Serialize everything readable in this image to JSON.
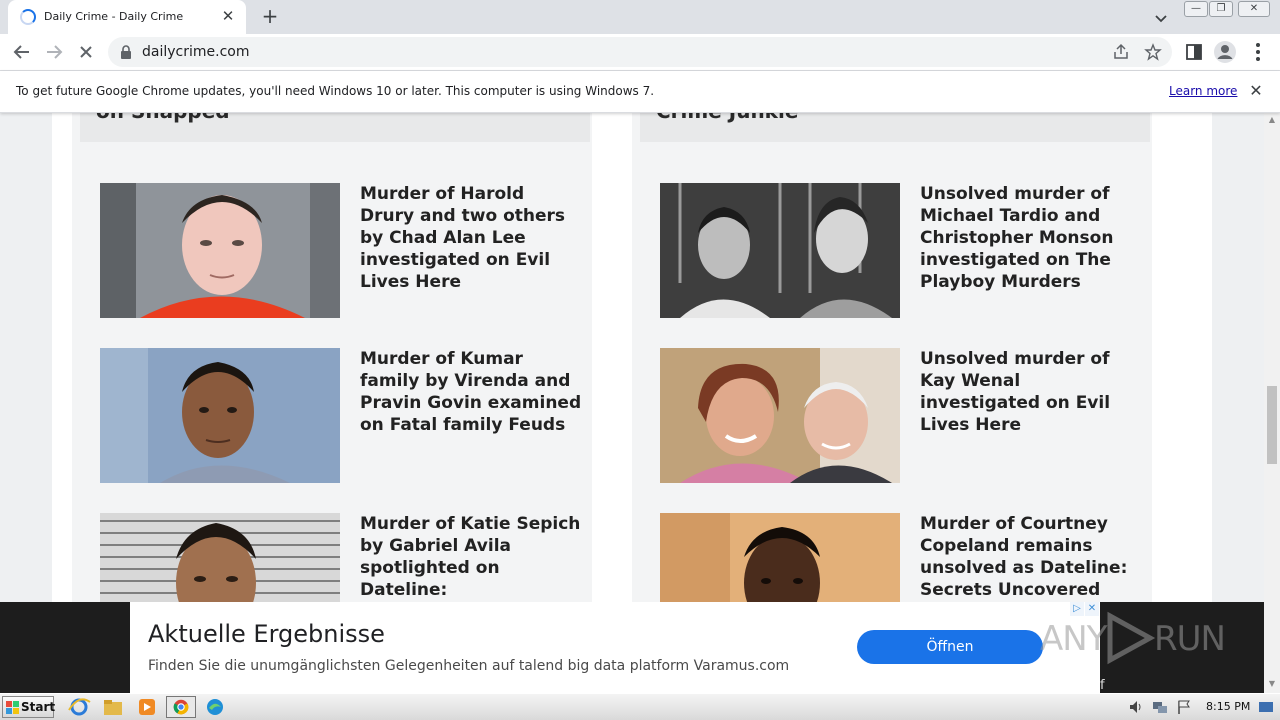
{
  "browser": {
    "tab": {
      "title": "Daily Crime - Daily Crime",
      "close": "✕"
    },
    "new_tab": "+",
    "url": "dailycrime.com",
    "window_controls": {
      "minimize": "—",
      "restore": "❐",
      "close": "✕"
    }
  },
  "infobar": {
    "message": "To get future Google Chrome updates, you'll need Windows 10 or later. This computer is using Windows 7.",
    "learn_more": "Learn more",
    "close": "✕"
  },
  "page": {
    "left_column": {
      "heading": "on Snapped",
      "articles": [
        {
          "title": "Murder of Harold Drury and two others by Chad Alan Lee investigated on Evil Lives Here",
          "photo": "mugshot-orange-jumpsuit"
        },
        {
          "title": "Murder of Kumar family by Virenda and Pravin Govin examined on Fatal family Feuds",
          "photo": "mugshot-blue-background"
        },
        {
          "title": "Murder of Katie Sepich by Gabriel Avila spotlighted on Dateline: Unforgettable",
          "photo": "mugshot-height-chart"
        }
      ]
    },
    "right_column": {
      "heading": "Crime Junkie",
      "articles": [
        {
          "title": "Unsolved murder of Michael Tardio and Christopher Monson investigated on The Playboy Murders",
          "photo": "bw-two-men"
        },
        {
          "title": "Unsolved murder of Kay Wenal investigated on Evil Lives Here",
          "photo": "couple-smiling"
        },
        {
          "title": "Murder of Courtney Copeland remains unsolved as Dateline: Secrets Uncovered",
          "photo": "portrait-young-man"
        }
      ]
    }
  },
  "ad": {
    "headline": "Aktuelle Ergebnisse",
    "description": "Finden Sie die unumgänglichsten Gelegenheiten auf talend big data platform Varamus.com",
    "cta": "Öffnen",
    "adchoices": "▷",
    "close": "✕",
    "edge_text": "f"
  },
  "watermark": {
    "text": "ANY RUN"
  },
  "taskbar": {
    "start_label": "Start",
    "clock": "8:15 PM"
  },
  "colors": {
    "accent": "#1a73e8",
    "link": "#1a0dab",
    "ad_button": "#1a73e8"
  }
}
